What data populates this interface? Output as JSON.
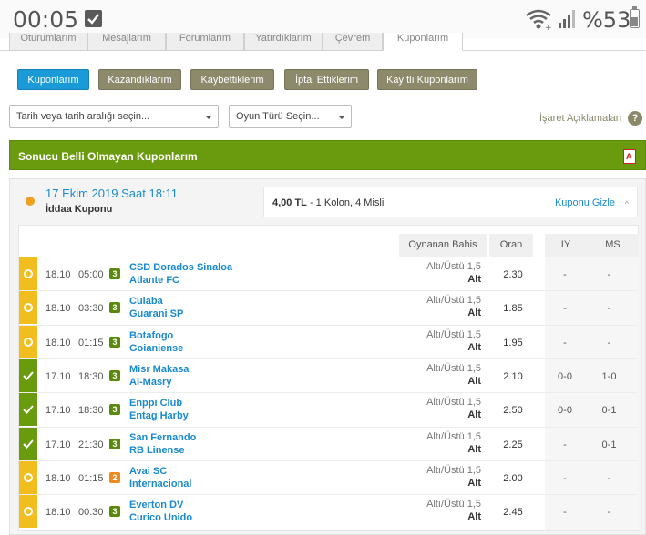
{
  "status_bar": {
    "time": "00:05",
    "battery_text": "%53"
  },
  "tabs": [
    "Oturumlarım",
    "Mesajlarım",
    "Forumlarım",
    "Yatırdıklarım",
    "Çevrem",
    "Kuponlarım"
  ],
  "filters": {
    "buttons": [
      "Kuponlarım",
      "Kazandıklarım",
      "Kaybettiklerim",
      "İptal Ettiklerim",
      "Kayıtlı Kuponlarım"
    ],
    "date_select": "Tarih veya tarih aralığı seçin...",
    "game_select": "Oyun Türü Seçin...",
    "legend_link": "İşaret Açıklamaları",
    "help_icon": "?"
  },
  "section": {
    "title": "Sonucu Belli Olmayan Kuponlarım"
  },
  "coupon": {
    "date": "17 Ekim 2019 Saat 18:11",
    "type": "İddaa Kuponu",
    "amount": "4,00 TL",
    "details": " - 1 Kolon, 4 Misli",
    "hide_label": "Kuponu Gizle",
    "hide_caret": "^"
  },
  "table": {
    "headers": {
      "bet": "Oynanan Bahis",
      "odd": "Oran",
      "iy": "IY",
      "ms": "MS"
    },
    "rows": [
      {
        "status": "pending",
        "date": "18.10",
        "time": "05:00",
        "mbs": "3",
        "mbs_color": "g",
        "home": "CSD Dorados Sinaloa",
        "away": "Atlante FC",
        "bet": "Altı/Üstü 1,5",
        "pick": "Alt",
        "odd": "2.30",
        "iy": "-",
        "ms": "-"
      },
      {
        "status": "pending",
        "date": "18.10",
        "time": "03:30",
        "mbs": "3",
        "mbs_color": "g",
        "home": "Cuiaba",
        "away": "Guarani SP",
        "bet": "Altı/Üstü 1,5",
        "pick": "Alt",
        "odd": "1.85",
        "iy": "-",
        "ms": "-"
      },
      {
        "status": "pending",
        "date": "18.10",
        "time": "01:15",
        "mbs": "3",
        "mbs_color": "g",
        "home": "Botafogo",
        "away": "Goianiense",
        "bet": "Altı/Üstü 1,5",
        "pick": "Alt",
        "odd": "1.95",
        "iy": "-",
        "ms": "-"
      },
      {
        "status": "won",
        "date": "17.10",
        "time": "18:30",
        "mbs": "3",
        "mbs_color": "g",
        "home": "Misr Makasa",
        "away": "Al-Masry",
        "bet": "Altı/Üstü 1,5",
        "pick": "Alt",
        "odd": "2.10",
        "iy": "0-0",
        "ms": "1-0"
      },
      {
        "status": "won",
        "date": "17.10",
        "time": "18:30",
        "mbs": "3",
        "mbs_color": "g",
        "home": "Enppi Club",
        "away": "Entag Harby",
        "bet": "Altı/Üstü 1,5",
        "pick": "Alt",
        "odd": "2.50",
        "iy": "0-0",
        "ms": "0-1"
      },
      {
        "status": "won",
        "date": "17.10",
        "time": "21:30",
        "mbs": "3",
        "mbs_color": "g",
        "home": "San Fernando",
        "away": "RB Linense",
        "bet": "Altı/Üstü 1,5",
        "pick": "Alt",
        "odd": "2.25",
        "iy": "-",
        "ms": "0-1"
      },
      {
        "status": "pending",
        "date": "18.10",
        "time": "01:15",
        "mbs": "2",
        "mbs_color": "o",
        "home": "Avai SC",
        "away": "Internacional",
        "bet": "Altı/Üstü 1,5",
        "pick": "Alt",
        "odd": "2.00",
        "iy": "-",
        "ms": "-"
      },
      {
        "status": "pending",
        "date": "18.10",
        "time": "00:30",
        "mbs": "3",
        "mbs_color": "g",
        "home": "Everton DV",
        "away": "Curico Unido",
        "bet": "Altı/Üstü 1,5",
        "pick": "Alt",
        "odd": "2.45",
        "iy": "-",
        "ms": "-"
      }
    ]
  }
}
